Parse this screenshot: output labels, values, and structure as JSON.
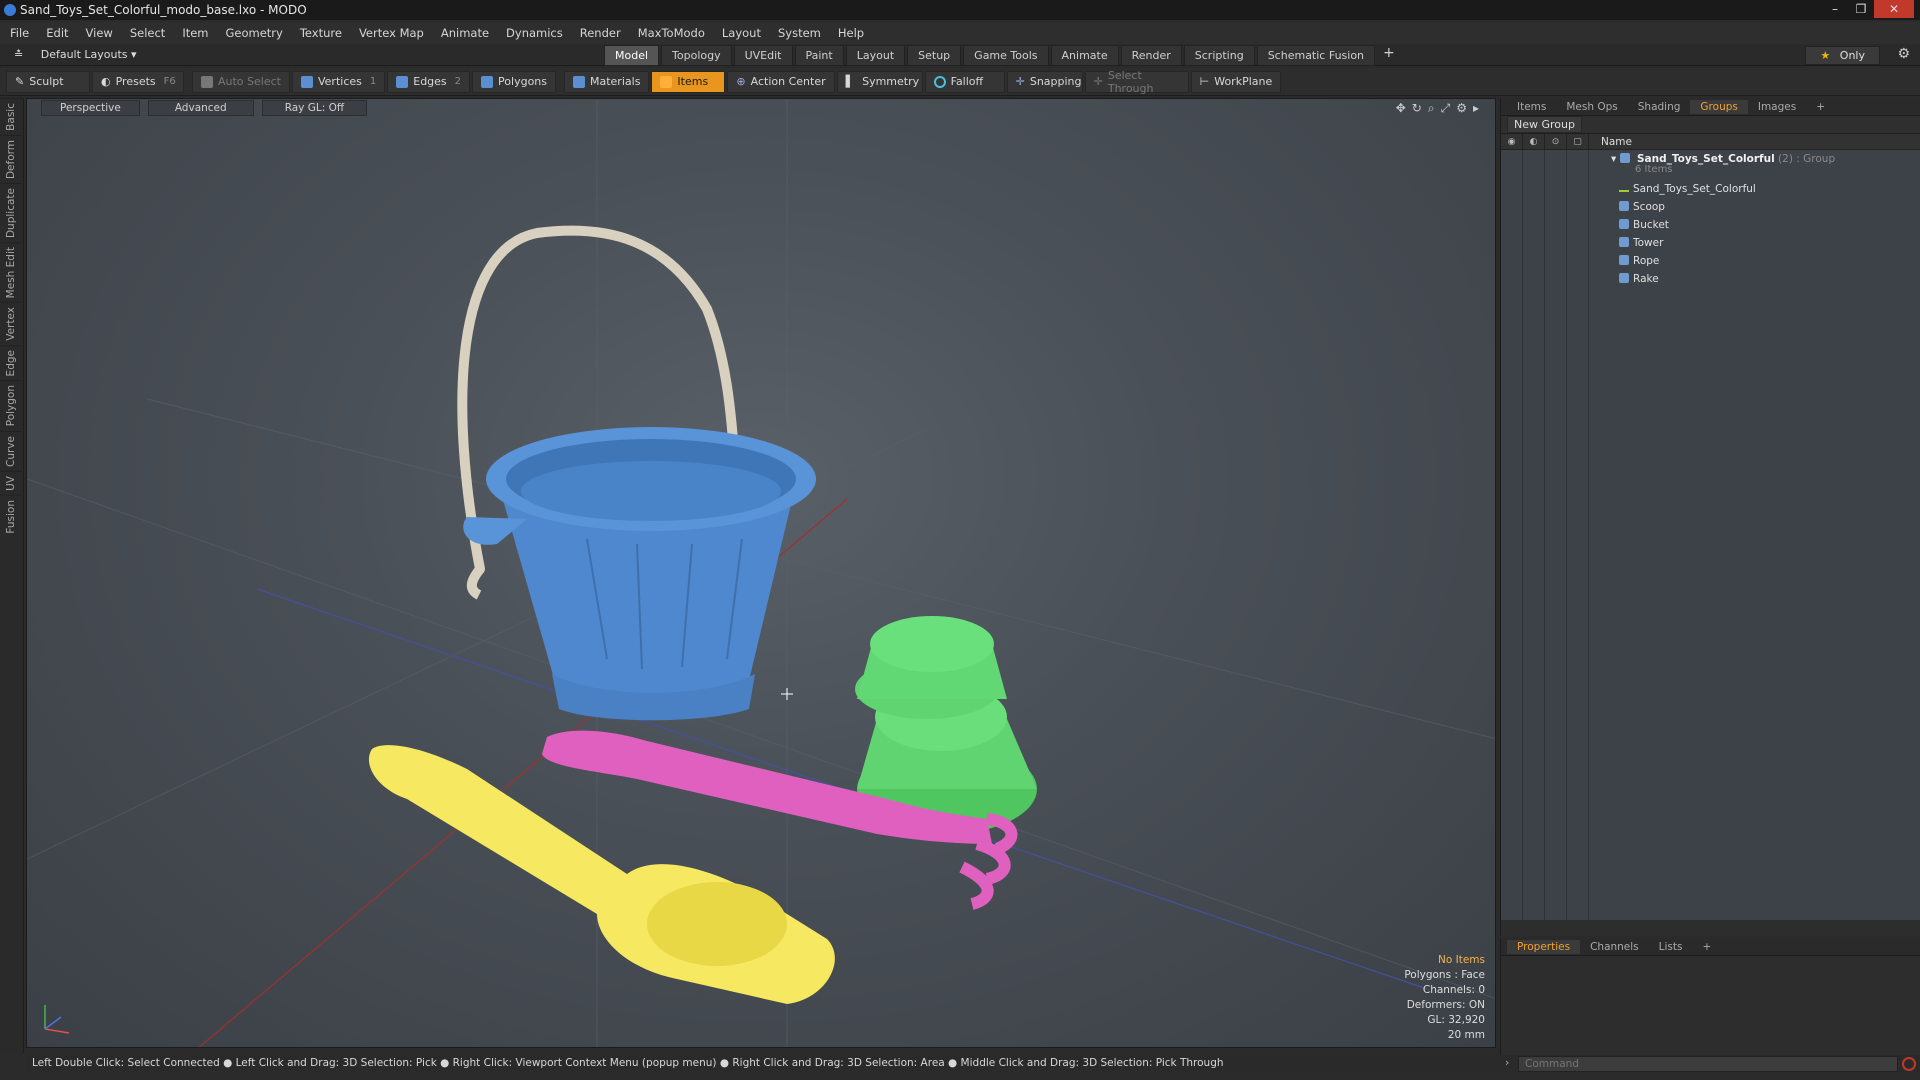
{
  "window": {
    "title": "Sand_Toys_Set_Colorful_modo_base.lxo - MODO"
  },
  "menu": [
    "File",
    "Edit",
    "View",
    "Select",
    "Item",
    "Geometry",
    "Texture",
    "Vertex Map",
    "Animate",
    "Dynamics",
    "Render",
    "MaxToModo",
    "Layout",
    "System",
    "Help"
  ],
  "layout": {
    "default_layouts": "Default Layouts",
    "tabs": [
      "Model",
      "Topology",
      "UVEdit",
      "Paint",
      "Layout",
      "Setup",
      "Game Tools",
      "Animate",
      "Render",
      "Scripting",
      "Schematic Fusion"
    ],
    "active_tab": "Model",
    "only_label": "Only"
  },
  "toolbar": {
    "sculpt": "Sculpt",
    "presets": "Presets",
    "presets_key": "F6",
    "auto_select": "Auto Select",
    "vertices": "Vertices",
    "vertices_key": "1",
    "edges": "Edges",
    "edges_key": "2",
    "polygons": "Polygons",
    "materials": "Materials",
    "items": "Items",
    "action_center": "Action Center",
    "symmetry": "Symmetry",
    "falloff": "Falloff",
    "snapping": "Snapping",
    "select_through": "Select Through",
    "workplane": "WorkPlane"
  },
  "left_tabs": [
    "Basic",
    "Deform",
    "Duplicate",
    "Mesh Edit",
    "Vertex",
    "Edge",
    "Polygon",
    "Curve",
    "UV",
    "Fusion"
  ],
  "viewport": {
    "perspective": "Perspective",
    "advanced": "Advanced",
    "raygl": "Ray GL: Off",
    "info": {
      "no_items": "No Items",
      "polygons": "Polygons : Face",
      "channels": "Channels: 0",
      "deformers": "Deformers: ON",
      "gl": "GL: 32,920",
      "scale": "20 mm"
    }
  },
  "right_panel": {
    "tabs": [
      "Items",
      "Mesh Ops",
      "Shading",
      "Groups",
      "Images"
    ],
    "active_tab": "Groups",
    "new_group": "New Group",
    "name_header": "Name",
    "group_name": "Sand_Toys_Set_Colorful",
    "group_count": "(2)",
    "group_type": ": Group",
    "group_items": "6 Items",
    "children": [
      "Sand_Toys_Set_Colorful",
      "Scoop",
      "Bucket",
      "Tower",
      "Rope",
      "Rake"
    ]
  },
  "properties": {
    "tabs": [
      "Properties",
      "Channels",
      "Lists"
    ],
    "active_tab": "Properties"
  },
  "status": {
    "text": "Left Double Click: Select Connected ● Left Click and Drag: 3D Selection: Pick ● Right Click: Viewport Context Menu (popup menu) ● Right Click and Drag: 3D Selection: Area ● Middle Click and Drag: 3D Selection: Pick Through"
  },
  "command": {
    "placeholder": "Command"
  }
}
